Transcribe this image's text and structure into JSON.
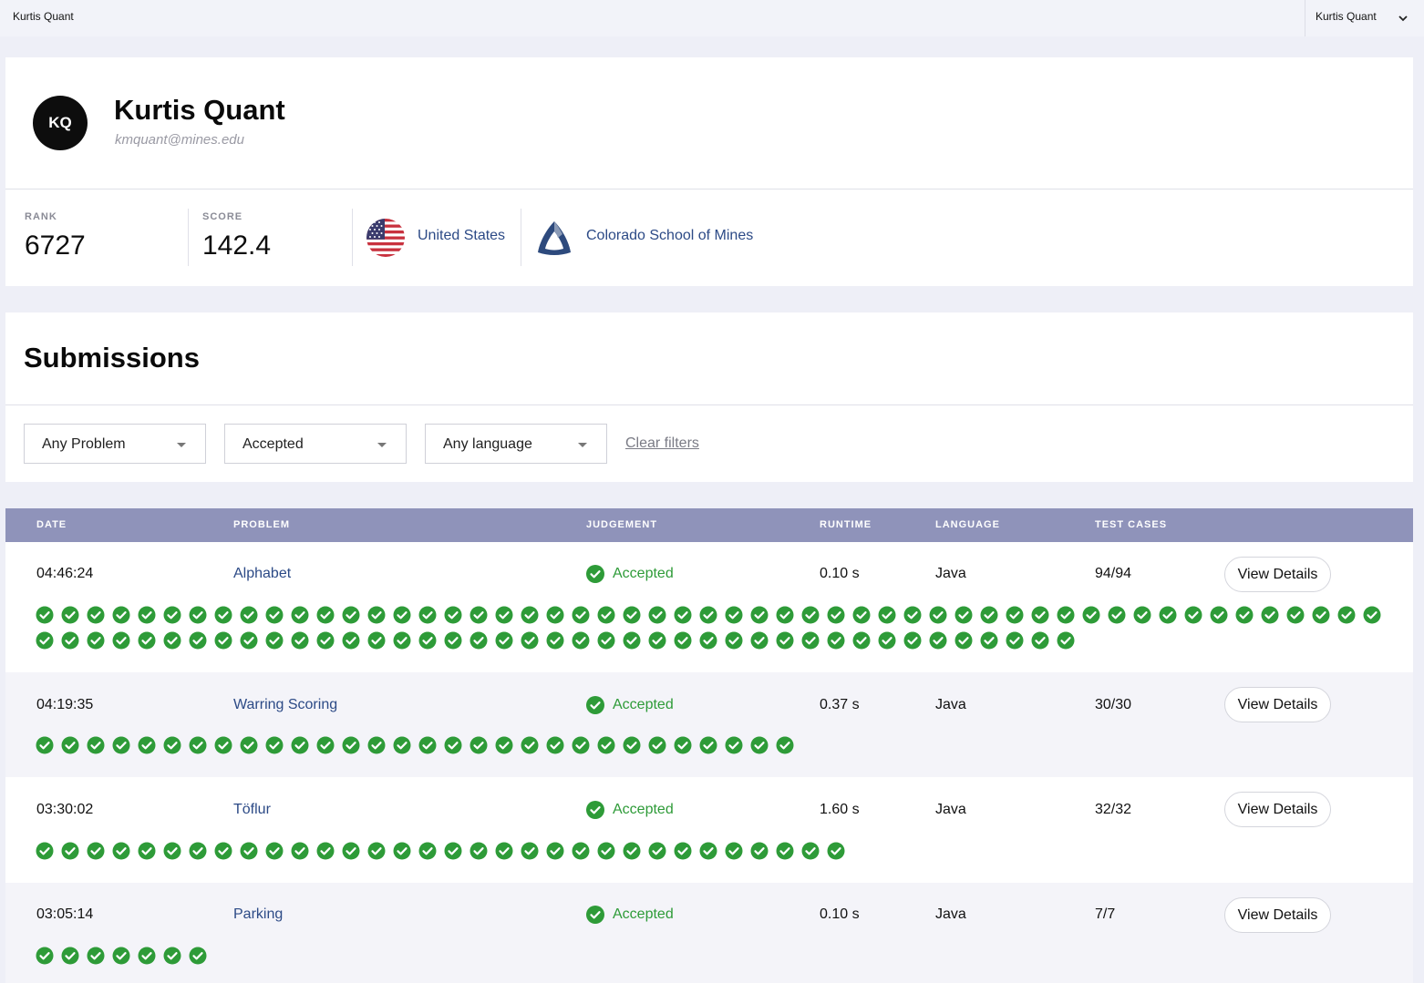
{
  "topbar": {
    "brand": "Kurtis Quant",
    "user": "Kurtis Quant"
  },
  "profile": {
    "initials": "KQ",
    "name": "Kurtis Quant",
    "email": "kmquant@mines.edu",
    "rank_label": "RANK",
    "rank": "6727",
    "score_label": "SCORE",
    "score": "142.4",
    "country": "United States",
    "school": "Colorado School of Mines"
  },
  "submissions": {
    "title": "Submissions",
    "filters": {
      "problem": "Any Problem",
      "judgement": "Accepted",
      "language": "Any language",
      "clear": "Clear filters"
    },
    "columns": [
      "DATE",
      "PROBLEM",
      "JUDGEMENT",
      "RUNTIME",
      "LANGUAGE",
      "TEST CASES"
    ],
    "rows": [
      {
        "date": "04:46:24",
        "problem": "Alphabet",
        "judgement": "Accepted",
        "runtime": "0.10 s",
        "language": "Java",
        "tests": "94/94",
        "details": "View Details",
        "passed": 94
      },
      {
        "date": "04:19:35",
        "problem": "Warring Scoring",
        "judgement": "Accepted",
        "runtime": "0.37 s",
        "language": "Java",
        "tests": "30/30",
        "details": "View Details",
        "passed": 30
      },
      {
        "date": "03:30:02",
        "problem": "Töflur",
        "judgement": "Accepted",
        "runtime": "1.60 s",
        "language": "Java",
        "tests": "32/32",
        "details": "View Details",
        "passed": 32
      },
      {
        "date": "03:05:14",
        "problem": "Parking",
        "judgement": "Accepted",
        "runtime": "0.10 s",
        "language": "Java",
        "tests": "7/7",
        "details": "View Details",
        "passed": 7
      }
    ]
  },
  "colors": {
    "accent": "#2c4a86",
    "success": "#2e9b38",
    "header": "#8f93ba"
  },
  "icons": {
    "check": "check-circle-icon",
    "flag": "us-flag-icon",
    "school": "school-logo-icon",
    "menu": "chevron-down-icon"
  }
}
